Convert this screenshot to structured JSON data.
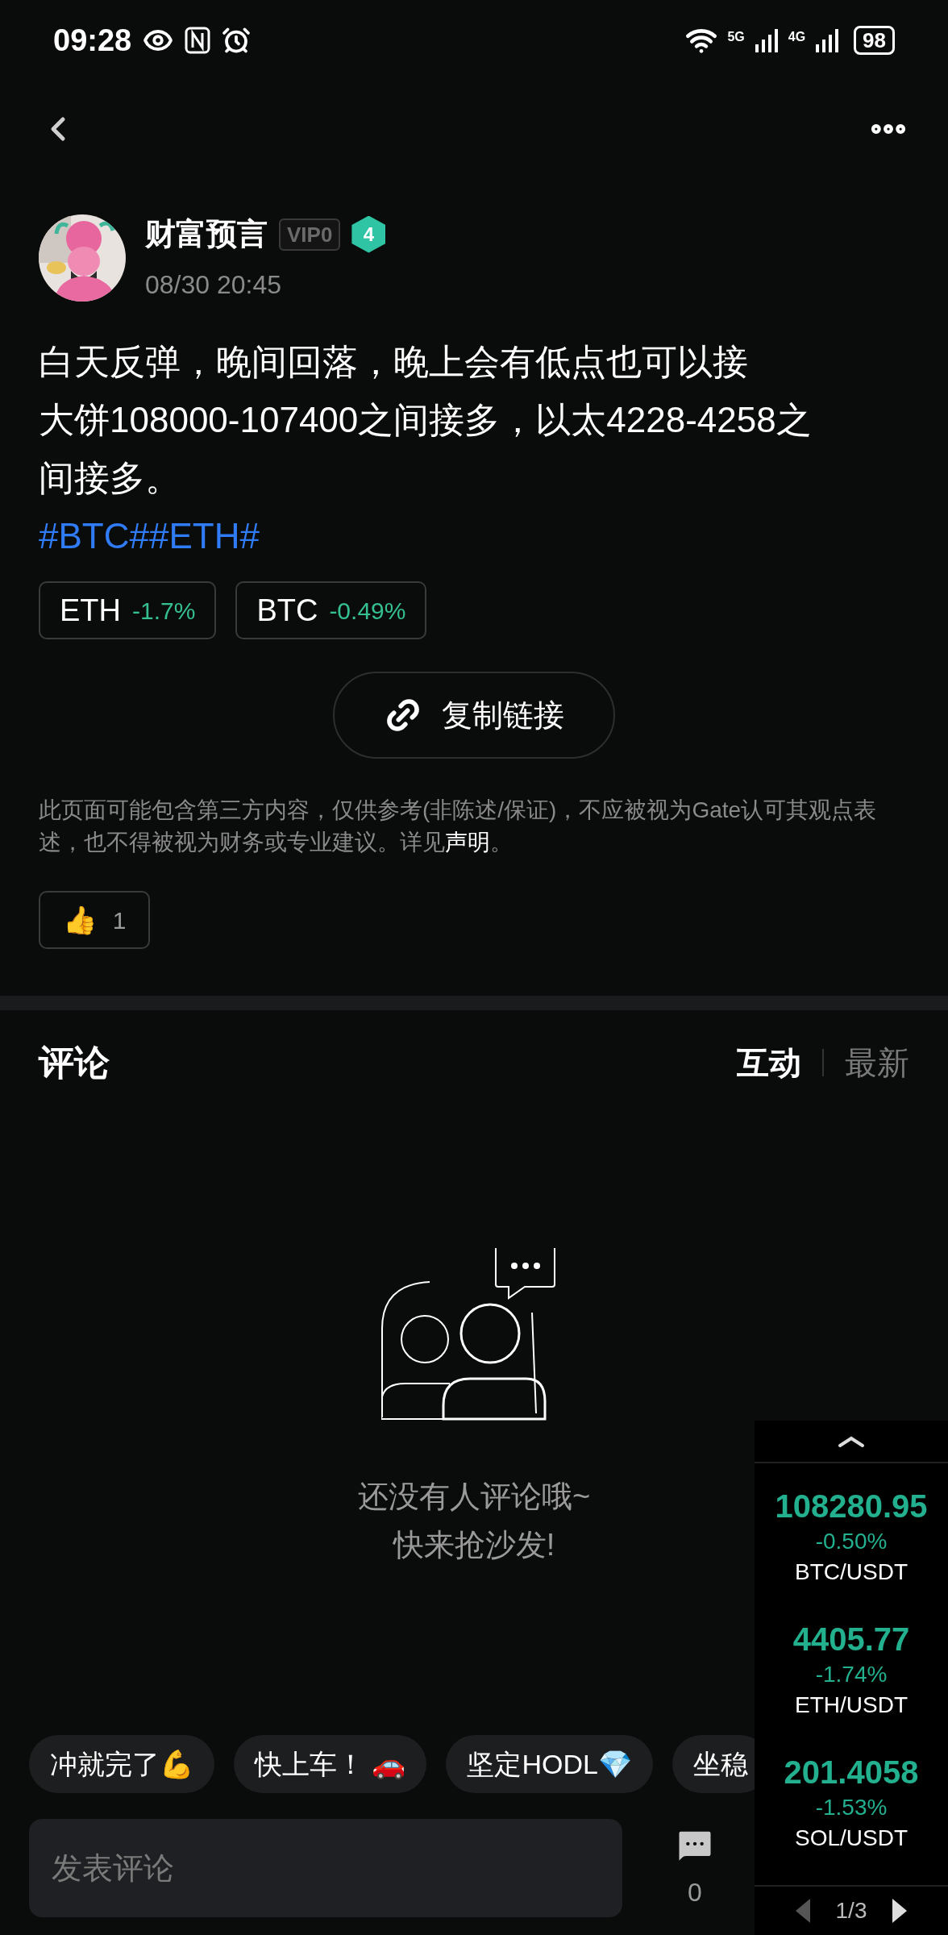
{
  "status_bar": {
    "time": "09:28",
    "network_1": "5G",
    "network_2": "4G",
    "battery": "98"
  },
  "author": {
    "name": "财富预言",
    "vip": "VIP0",
    "level_badge": "4",
    "time": "08/30 20:45"
  },
  "post": {
    "paragraphs": [
      "白天反弹，晚间回落，晚上会有低点也可以接",
      "大饼108000-107400之间接多，以太4228-4258之间接多。"
    ],
    "hashtags": "#BTC##ETH#"
  },
  "coins": [
    {
      "symbol": "ETH",
      "change": "-1.7%"
    },
    {
      "symbol": "BTC",
      "change": "-0.49%"
    }
  ],
  "copy_link_button": "复制链接",
  "disclaimer": {
    "text": "此页面可能包含第三方内容，仅供参考(非陈述/保证)，不应被视为Gate认可其观点表述，也不得被视为财务或专业建议。详见",
    "link": "声明",
    "end": "。"
  },
  "reactions": [
    {
      "emoji": "👍",
      "count": "1"
    }
  ],
  "comments": {
    "title": "评论",
    "sort_tabs": [
      {
        "label": "互动",
        "selected": true
      },
      {
        "label": "最新",
        "selected": false
      }
    ],
    "empty_lines": [
      "还没有人评论哦~",
      "快来抢沙发!"
    ]
  },
  "quick_replies": [
    "冲就完了💪",
    "快上车！ 🚗",
    "坚定HODL💎",
    "坐稳"
  ],
  "comment_input": {
    "placeholder": "发表评论"
  },
  "actions": [
    {
      "kind": "comment",
      "count": "0"
    }
  ],
  "ticker": {
    "items": [
      {
        "price": "108280.95",
        "change": "-0.50%",
        "pair": "BTC/USDT"
      },
      {
        "price": "4405.77",
        "change": "-1.74%",
        "pair": "ETH/USDT"
      },
      {
        "price": "201.4058",
        "change": "-1.53%",
        "pair": "SOL/USDT"
      }
    ],
    "page": "1/3"
  }
}
